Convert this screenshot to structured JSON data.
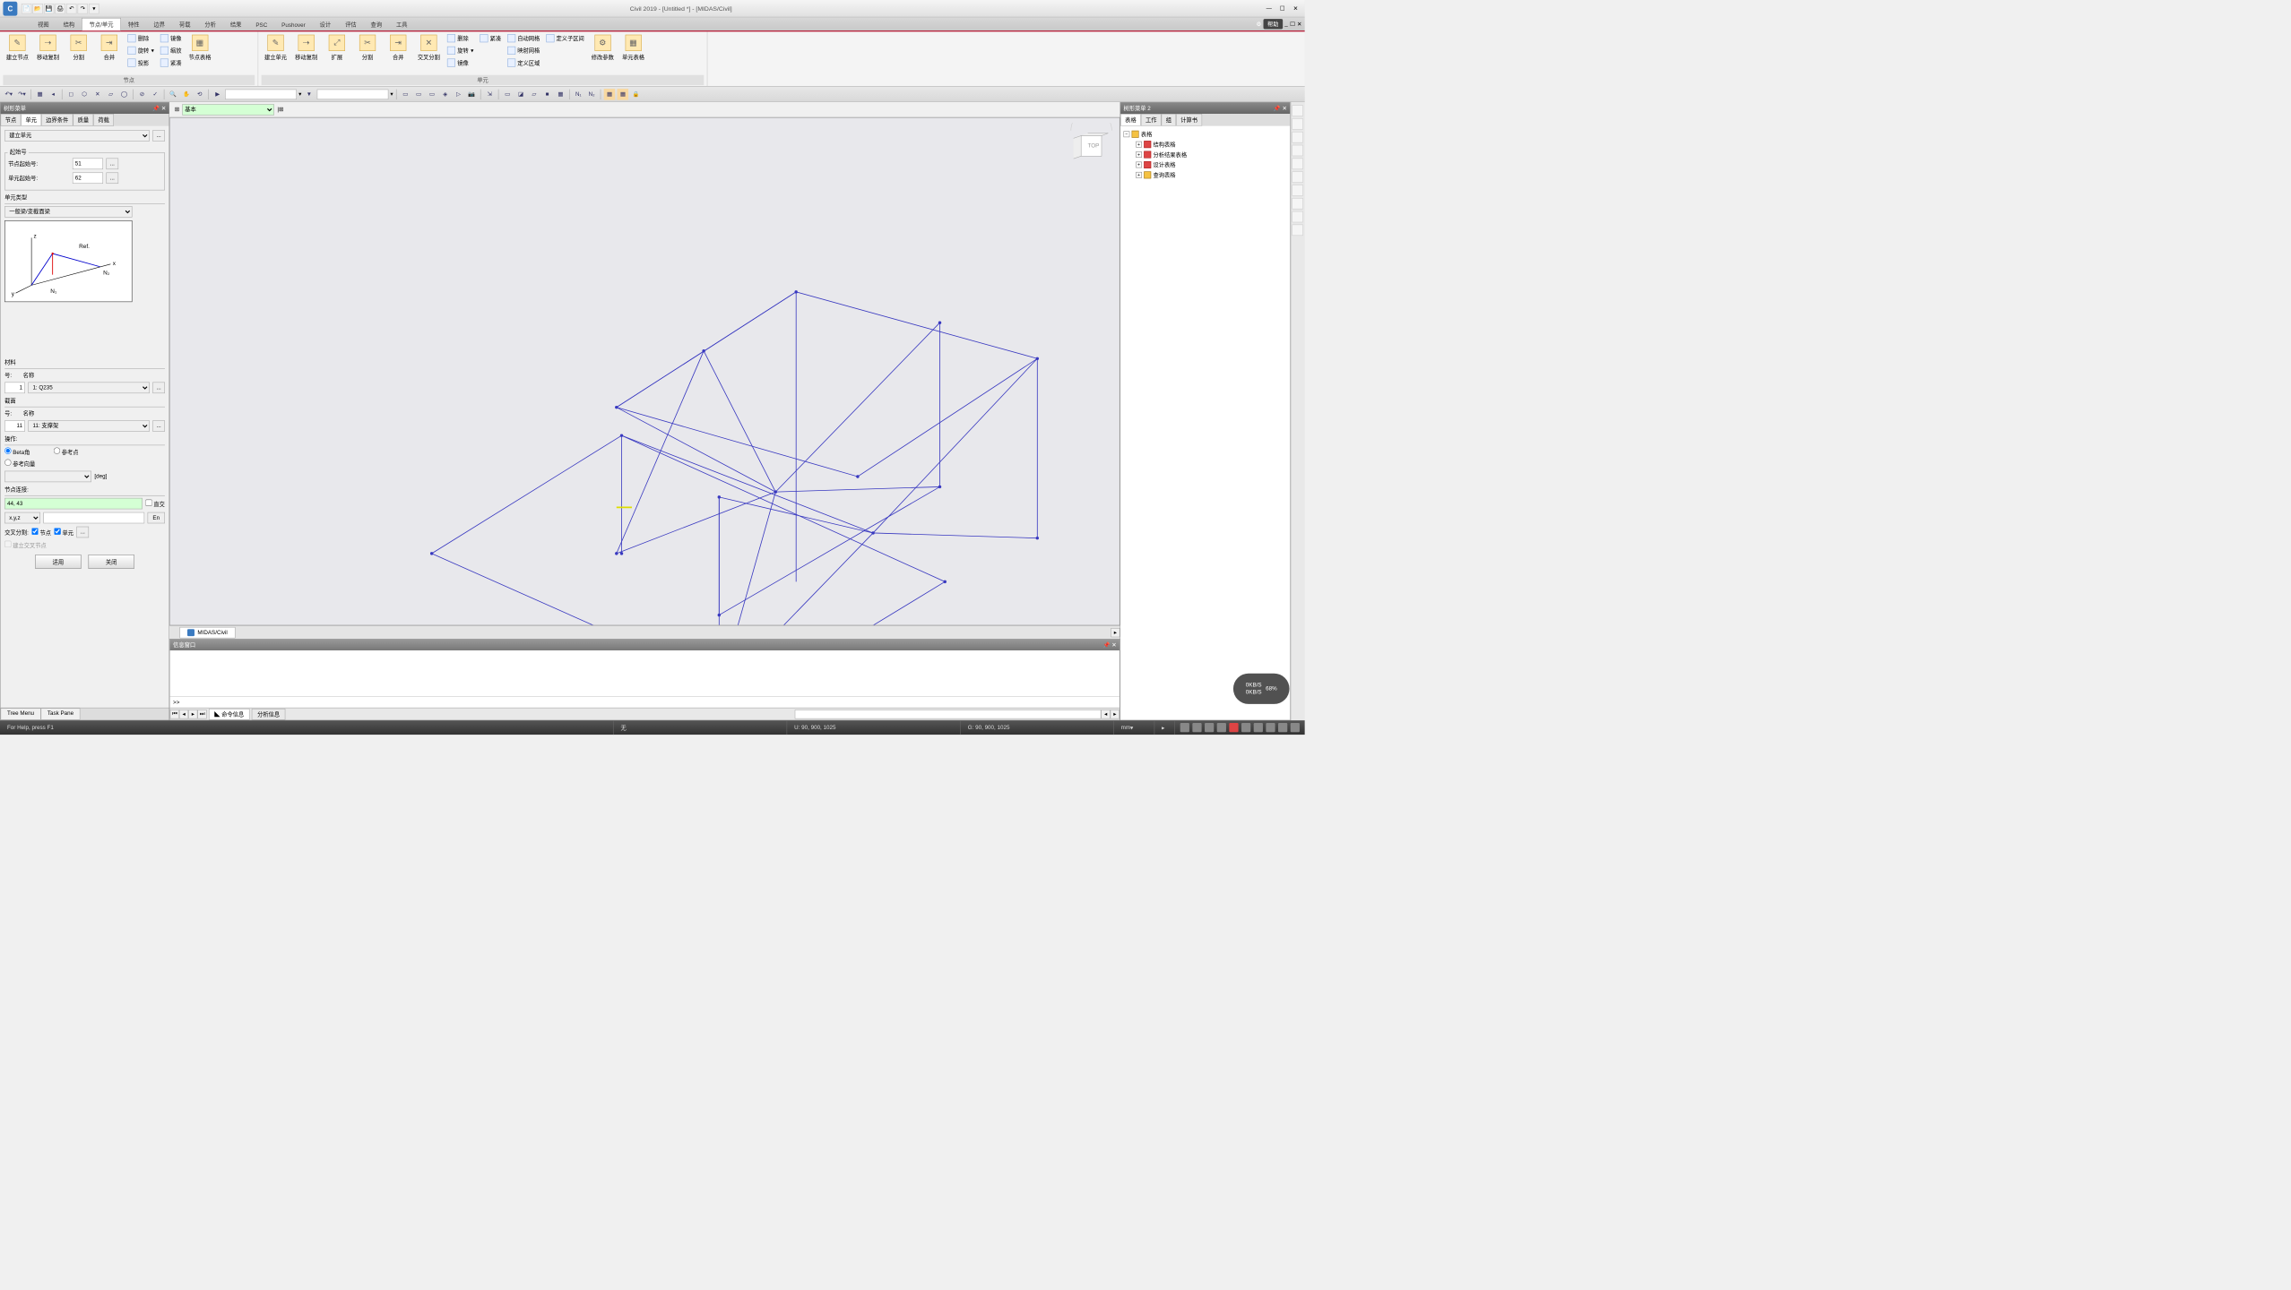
{
  "title": "Civil 2019 - [Untitled *] - [MIDAS/Civil]",
  "help_label": "帮助",
  "ribbon_tabs": [
    "视图",
    "结构",
    "节点/单元",
    "特性",
    "边界",
    "荷载",
    "分析",
    "结果",
    "PSC",
    "Pushover",
    "设计",
    "评估",
    "查询",
    "工具"
  ],
  "active_ribbon_tab": 2,
  "ribbon_groups": {
    "nodes_label": "节点",
    "elements_label": "单元",
    "n_create_node": "建立节点",
    "n_move_copy": "移动复制",
    "n_split": "分割",
    "n_merge": "合并",
    "n_delete": "删除",
    "n_mirror": "镜像",
    "n_rotate": "旋转",
    "n_scale": "缩放",
    "n_project": "投影",
    "n_compress": "紧凑",
    "n_node_table": "节点表格",
    "e_create_elem": "建立单元",
    "e_move_copy": "移动复制",
    "e_expand": "扩展",
    "e_split": "分割",
    "e_merge": "合并",
    "e_cross_split": "交叉分割",
    "e_delete": "删除",
    "e_rotate": "旋转",
    "e_mirror": "镜像",
    "e_compress": "紧凑",
    "e_auto_mesh": "自动网格",
    "e_map_mesh": "映射网格",
    "e_define_area": "定义区域",
    "e_define_subarea": "定义子区间",
    "e_modify_params": "修改参数",
    "e_elem_table": "单元表格"
  },
  "left_panel": {
    "title": "树形菜单",
    "tabs": [
      "节点",
      "单元",
      "边界条件",
      "质量",
      "荷载"
    ],
    "active_tab": 1,
    "action": "建立单元",
    "start_group": "起始号",
    "node_start_label": "节点起始号:",
    "node_start": "51",
    "elem_start_label": "单元起始号:",
    "elem_start": "62",
    "elem_type_label": "单元类型",
    "elem_type": "一般梁/变截面梁",
    "diagram_ref": "Ref.",
    "diagram_n1": "N₁",
    "diagram_n2": "N₂",
    "material_label": "材料",
    "material_no_label": "号:",
    "material_name_label": "名称",
    "material_no": "1",
    "material_name": "1: Q235",
    "section_label": "截面",
    "section_no": "11",
    "section_name": "11: 支撑架",
    "operation_label": "操作:",
    "opt_beta": "Beta角",
    "opt_refpoint": "参考点",
    "opt_refvec": "参考向量",
    "deg": "[deg]",
    "node_connect_label": "节点连接:",
    "node_connect": "44, 43",
    "ortho": "直交",
    "xyz": "x,y,z",
    "en": "En",
    "cross_split_label": "交叉分割:",
    "chk_node": "节点",
    "chk_elem": "单元",
    "chk_build_cross": "建立交叉节点",
    "apply": "适用",
    "close": "关闭",
    "bottom_tabs": [
      "Tree Menu",
      "Task Pane"
    ]
  },
  "viewport": {
    "layer_select": "基本",
    "tab_name": "MIDAS/Civil"
  },
  "info_panel": {
    "title": "信息窗口",
    "prompt": ">>",
    "tabs": [
      "命令信息",
      "分析信息"
    ]
  },
  "right_panel": {
    "title": "树形菜单 2",
    "tabs": [
      "表格",
      "工作",
      "组",
      "计算书"
    ],
    "active_tab": 0,
    "tree": {
      "root": "表格",
      "items": [
        "结构表格",
        "分析结果表格",
        "设计表格",
        "查询表格"
      ]
    }
  },
  "statusbar": {
    "help": "For Help, press F1",
    "none": "无",
    "u_coord": "U: 90, 900, 1025",
    "g_coord": "G: 90, 900, 1025",
    "unit": "mm"
  },
  "badge": "68%",
  "badge_sub1": "0KB/S",
  "badge_sub2": "0KB/S"
}
